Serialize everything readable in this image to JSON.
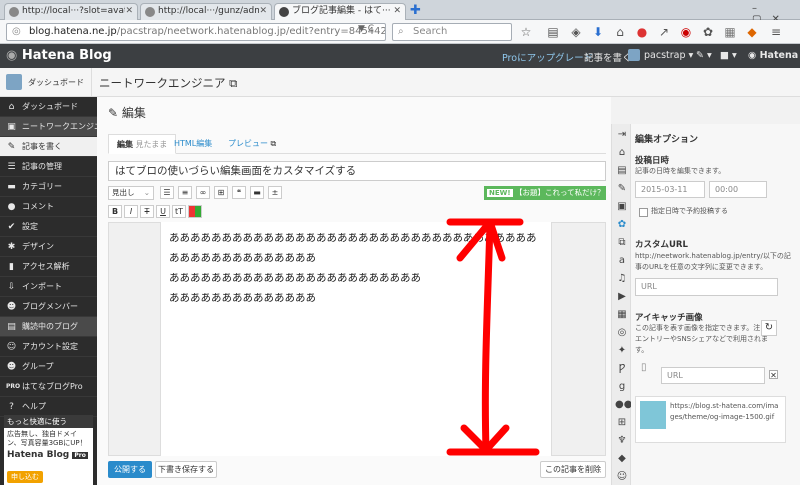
{
  "browser": {
    "tabs": [
      {
        "title": "http://local···?slot=avatar"
      },
      {
        "title": "http://local···/gunz/admin/"
      },
      {
        "title": "ブログ記事編集 - はて···"
      }
    ],
    "url_host": "blog.hatena.ne.jp",
    "url_path": "/pacstrap/neetwork.hatenablog.jp/edit?entry=845442045008781",
    "search_placeholder": "Search"
  },
  "header": {
    "logo": "Hatena Blog",
    "pro_upgrade": "Proにアップグレード",
    "write": "記事を書く",
    "user": "pacstrap",
    "brand": "Hatena"
  },
  "titlebar": {
    "dashboard": "ダッシュボード",
    "blog_name": "ニートワークエンジニア"
  },
  "sidebar": {
    "items": [
      {
        "label": "ダッシュボード",
        "icon": "home-icon"
      },
      {
        "label": "ニートワークエンジニア",
        "icon": "blog-icon"
      },
      {
        "label": "記事を書く",
        "icon": "pencil-icon"
      },
      {
        "label": "記事の管理",
        "icon": "list-icon"
      },
      {
        "label": "カテゴリー",
        "icon": "folder-icon"
      },
      {
        "label": "コメント",
        "icon": "comment-icon"
      },
      {
        "label": "設定",
        "icon": "wrench-icon"
      },
      {
        "label": "デザイン",
        "icon": "palette-icon"
      },
      {
        "label": "アクセス解析",
        "icon": "chart-icon"
      },
      {
        "label": "インポート",
        "icon": "import-icon"
      },
      {
        "label": "ブログメンバー",
        "icon": "members-icon"
      },
      {
        "label": "購読中のブログ",
        "icon": "subscribe-icon"
      },
      {
        "label": "アカウント設定",
        "icon": "account-icon"
      },
      {
        "label": "グループ",
        "icon": "group-icon"
      },
      {
        "label": "はてなブログPro",
        "icon": "pro-icon"
      },
      {
        "label": "ヘルプ",
        "icon": "help-icon"
      }
    ],
    "promo": {
      "heading": "もっと快適に使う",
      "text": "広告無し、独自ドメイン、写真容量3GBにUP！",
      "logo": "Hatena Blog",
      "badge": "Pro",
      "button": "申し込む"
    }
  },
  "editor": {
    "page_title": "編集",
    "tabs": {
      "edit": "編集",
      "edit_mode": "見たまま",
      "html": "HTML編集",
      "preview": "プレビュー"
    },
    "title_value": "はてブロの使いづらい編集画面をカスタマイズする",
    "format_select": "見出し",
    "new_badge": "NEW!",
    "new_text": "【お題】これって私だけ？",
    "body_lines": [
      "あああああああああああああああああああああああああああああああああああああああああああああああああ",
      "ああああああああああああああああああああああああ",
      "ああああああああああああああ"
    ],
    "publish": "公開する",
    "save_draft": "下書き保存する",
    "delete": "この記事を削除"
  },
  "options": {
    "heading": "編集オプション",
    "date_heading": "投稿日時",
    "date_desc": "記事の日時を編集できます。",
    "date_value": "2015-03-11",
    "time_value": "00:00",
    "schedule_label": "指定日時で予約投稿する",
    "custom_url_heading": "カスタムURL",
    "custom_url_desc1": "http://neetwork.hatenablog.jp/entry/以下の記",
    "custom_url_desc2": "事のURLを任意の文字列に変更できます。",
    "url_placeholder": "URL",
    "eyecatch_heading": "アイキャッチ画像",
    "eyecatch_desc1": "この記事を表す画像を指定できます。注目",
    "eyecatch_desc2": "エントリーやSNSシェアなどで利用されま",
    "eyecatch_desc3": "す。",
    "eyecatch_url_placeholder": "URL",
    "og_url": "https://blog.st-hatena.com/images/theme/og-image-1500.gif"
  },
  "colors": {
    "accent": "#2a8bcb",
    "sidebar": "#2c2c2c",
    "annotation": "#ff0000"
  }
}
